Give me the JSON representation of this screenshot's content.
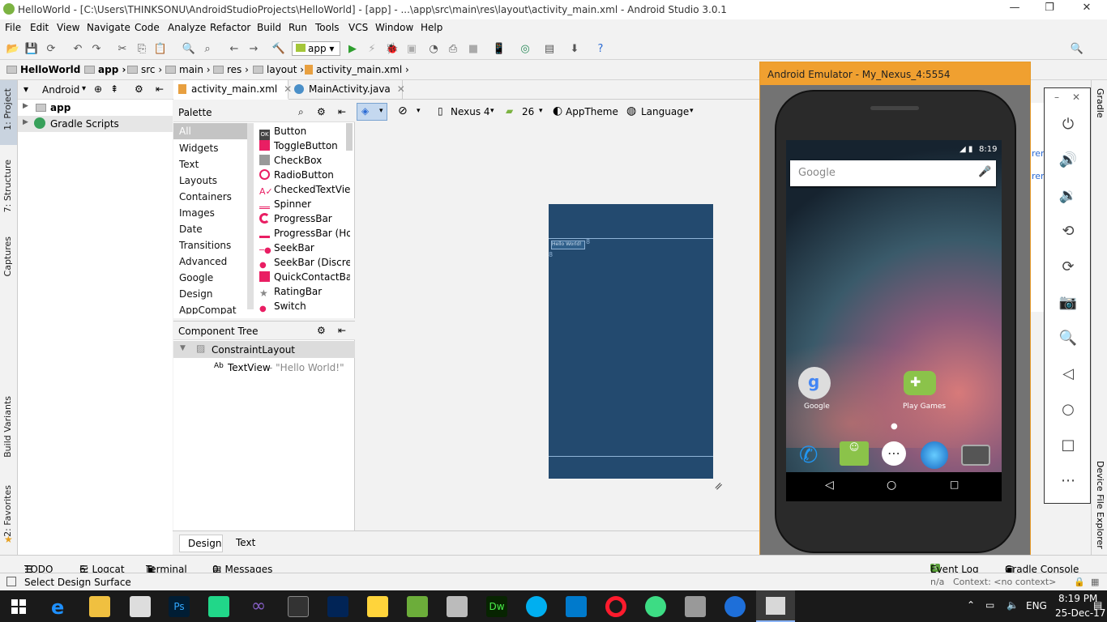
{
  "window": {
    "title": "HelloWorld - [C:\\Users\\THINKSONU\\AndroidStudioProjects\\HelloWorld] - [app] - ...\\app\\src\\main\\res\\layout\\activity_main.xml - Android Studio 3.0.1",
    "minimize": "—",
    "restore": "❐",
    "close": "✕"
  },
  "menu": [
    "File",
    "Edit",
    "View",
    "Navigate",
    "Code",
    "Analyze",
    "Refactor",
    "Build",
    "Run",
    "Tools",
    "VCS",
    "Window",
    "Help"
  ],
  "toolbar": {
    "run_config": "app"
  },
  "breadcrumbs": [
    "HelloWorld",
    "app",
    "src",
    "main",
    "res",
    "layout",
    "activity_main.xml"
  ],
  "left_tabs": [
    "1: Project",
    "7: Structure",
    "Captures",
    "Build Variants",
    "2: Favorites"
  ],
  "project": {
    "view_mode": "Android",
    "items": [
      "app",
      "Gradle Scripts"
    ]
  },
  "editor_tabs": [
    "activity_main.xml",
    "MainActivity.java"
  ],
  "palette": {
    "title": "Palette",
    "categories": [
      "All",
      "Widgets",
      "Text",
      "Layouts",
      "Containers",
      "Images",
      "Date",
      "Transitions",
      "Advanced",
      "Google",
      "Design",
      "AppCompat"
    ],
    "items": [
      "Button",
      "ToggleButton",
      "CheckBox",
      "RadioButton",
      "CheckedTextView",
      "Spinner",
      "ProgressBar",
      "ProgressBar (Ho",
      "SeekBar",
      "SeekBar (Discrete",
      "QuickContactBa",
      "RatingBar",
      "Switch"
    ]
  },
  "design_toolbar": {
    "device": "Nexus 4",
    "api": "26",
    "theme": "AppTheme",
    "language": "Language",
    "margin": "8"
  },
  "component_tree": {
    "title": "Component Tree",
    "root": "ConstraintLayout",
    "child_type": "TextView",
    "child_text": " - \"Hello World!\""
  },
  "canvas": {
    "widget_text": "Hello World!",
    "margin_label": "8"
  },
  "editor_bottom_tabs": [
    "Design",
    "Text"
  ],
  "emulator": {
    "title": "Android Emulator - My_Nexus_4:5554",
    "clock": "8:19",
    "search_placeholder": "Google",
    "apps": [
      "Google",
      "Play Games"
    ],
    "side_controls": [
      "power-icon",
      "volume-up-icon",
      "volume-down-icon",
      "rotate-left-icon",
      "rotate-right-icon",
      "camera-icon",
      "zoom-icon",
      "back-icon",
      "home-icon",
      "overview-icon",
      "more-icon"
    ]
  },
  "right_tabs": [
    "Gradle",
    "Device File Explorer"
  ],
  "bottom_tabs": [
    "TODO",
    "6: Logcat",
    "Terminal",
    "0: Messages"
  ],
  "bottom_right_tabs": [
    "Event Log",
    "Gradle Console"
  ],
  "event_log_count": "1",
  "status": {
    "message": "Select Design Surface",
    "position": "n/a",
    "context": "Context: <no context>"
  },
  "taskbar": {
    "language": "ENG",
    "time": "8:19 PM",
    "date": "25-Dec-17"
  },
  "colors": {
    "accent": "#f0a030",
    "blueprint": "#234a6f",
    "selection": "#dbe4f0"
  }
}
